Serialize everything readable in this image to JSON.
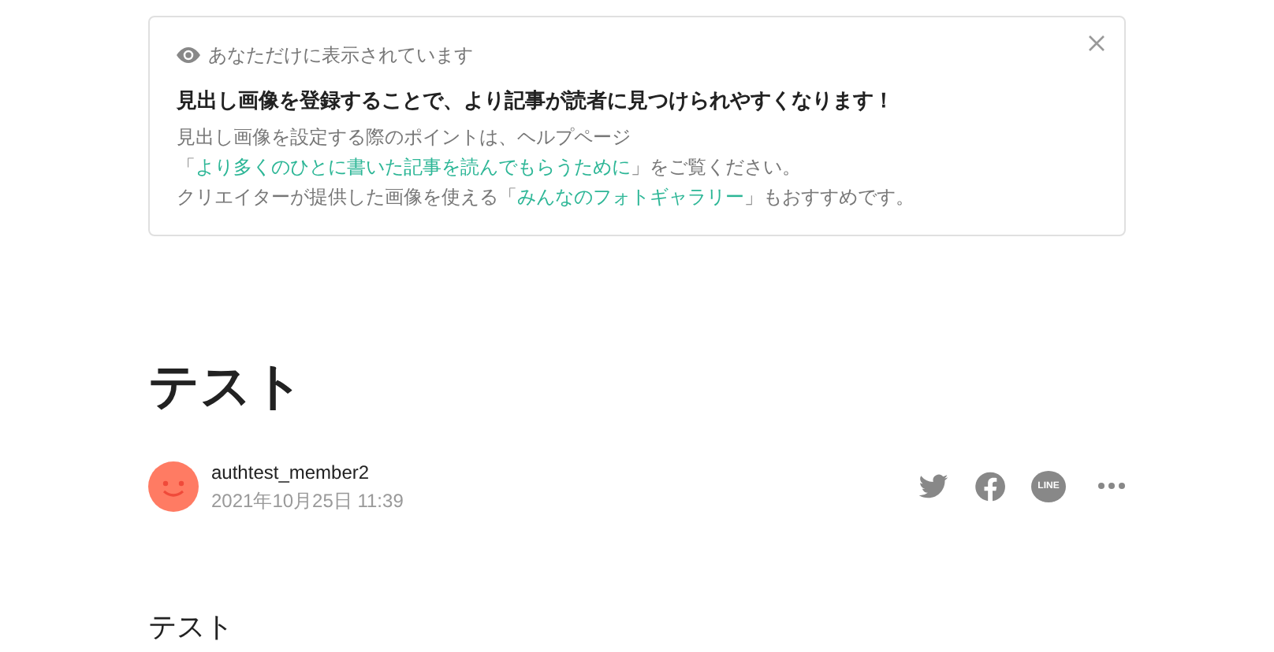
{
  "notice": {
    "visibility": "あなただけに表示されています",
    "headline": "見出し画像を登録することで、より記事が読者に見つけられやすくなります！",
    "lines": [
      {
        "before": "見出し画像を設定する際のポイントは、ヘルプページ「",
        "link": "より多くのひとに書いた記事を読んでもらうために",
        "after": "」をご覧ください。"
      },
      {
        "before": "クリエイターが提供した画像を使える「",
        "link": "みんなのフォトギャラリー",
        "after": "」もおすすめです。"
      }
    ]
  },
  "article": {
    "title": "テスト",
    "author": "authtest_member2",
    "date": "2021年10月25日 11:39",
    "line_icon_text": "LINE",
    "body": "テスト"
  }
}
